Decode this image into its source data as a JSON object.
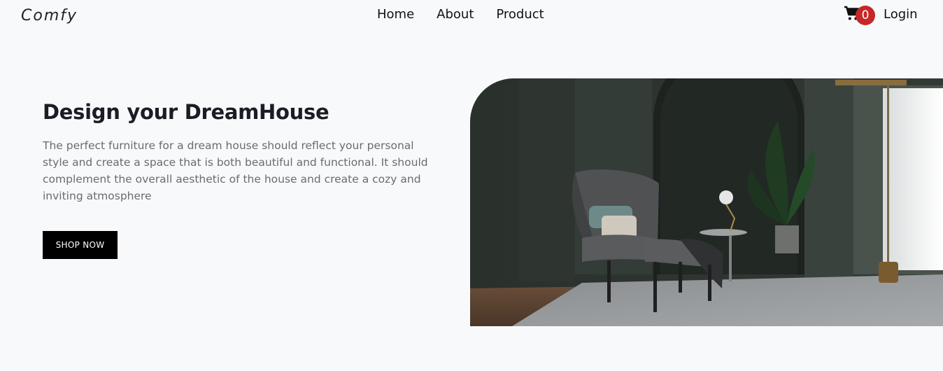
{
  "brand": {
    "logo": "Comfy"
  },
  "nav": {
    "links": [
      {
        "label": "Home"
      },
      {
        "label": "About"
      },
      {
        "label": "Product"
      }
    ],
    "cart_count": "0",
    "login_label": "Login"
  },
  "hero": {
    "title": "Design your DreamHouse",
    "description": "The perfect furniture for a dream house should reflect your personal style and create a space that is both beautiful and functional. It should complement the overall aesthetic of the house and create a cozy and inviting atmosphere",
    "cta_label": "SHOP NOW"
  },
  "colors": {
    "badge": "#c62828",
    "button": "#000000",
    "background": "#f8f9fb"
  },
  "icons": {
    "cart": "shopping-cart-icon"
  }
}
